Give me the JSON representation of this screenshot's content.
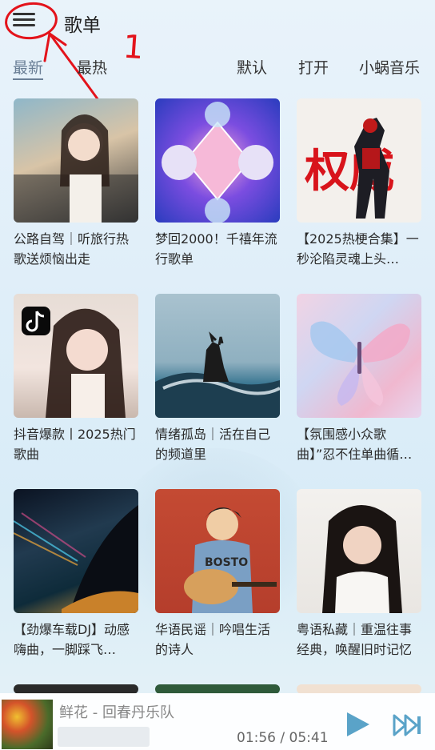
{
  "header": {
    "title": "歌单"
  },
  "annotation": {
    "text": "1"
  },
  "tabs": [
    {
      "label": "最新",
      "active": true
    },
    {
      "label": "最热",
      "active": false
    },
    {
      "label": "默认",
      "active": false
    },
    {
      "label": "打开",
      "active": false
    },
    {
      "label": "小蜗音乐",
      "active": false
    }
  ],
  "playlists": [
    {
      "title": "公路自驾｜听旅行热歌送烦恼出走"
    },
    {
      "title": "梦回2000！千禧年流行歌单"
    },
    {
      "title": "【2025热梗合集】一秒沦陷灵魂上头…",
      "cover_text": "权威"
    },
    {
      "title": "抖音爆款丨2025热门歌曲"
    },
    {
      "title": "情绪孤岛｜活在自己的频道里"
    },
    {
      "title": "【氛围感小众歌曲】”忍不住单曲循…"
    },
    {
      "title": "【劲爆车载DJ】动感嗨曲，一脚踩飞…"
    },
    {
      "title": "华语民谣｜吟唱生活的诗人",
      "cover_text": "BOSTO"
    },
    {
      "title": "粤语私藏｜重温往事经典，唤醒旧时记忆"
    }
  ],
  "player": {
    "song": "鲜花 - 回春丹乐队",
    "current_time": "01:56",
    "total_time": "05:41",
    "time_display": "01:56 / 05:41"
  },
  "colors": {
    "accent": "#6a7f96",
    "annotation_red": "#e3131b",
    "play_button": "#5aa3c8"
  },
  "icons": {
    "menu": "hamburger-menu-icon",
    "play": "play-icon",
    "next": "skip-next-icon"
  }
}
